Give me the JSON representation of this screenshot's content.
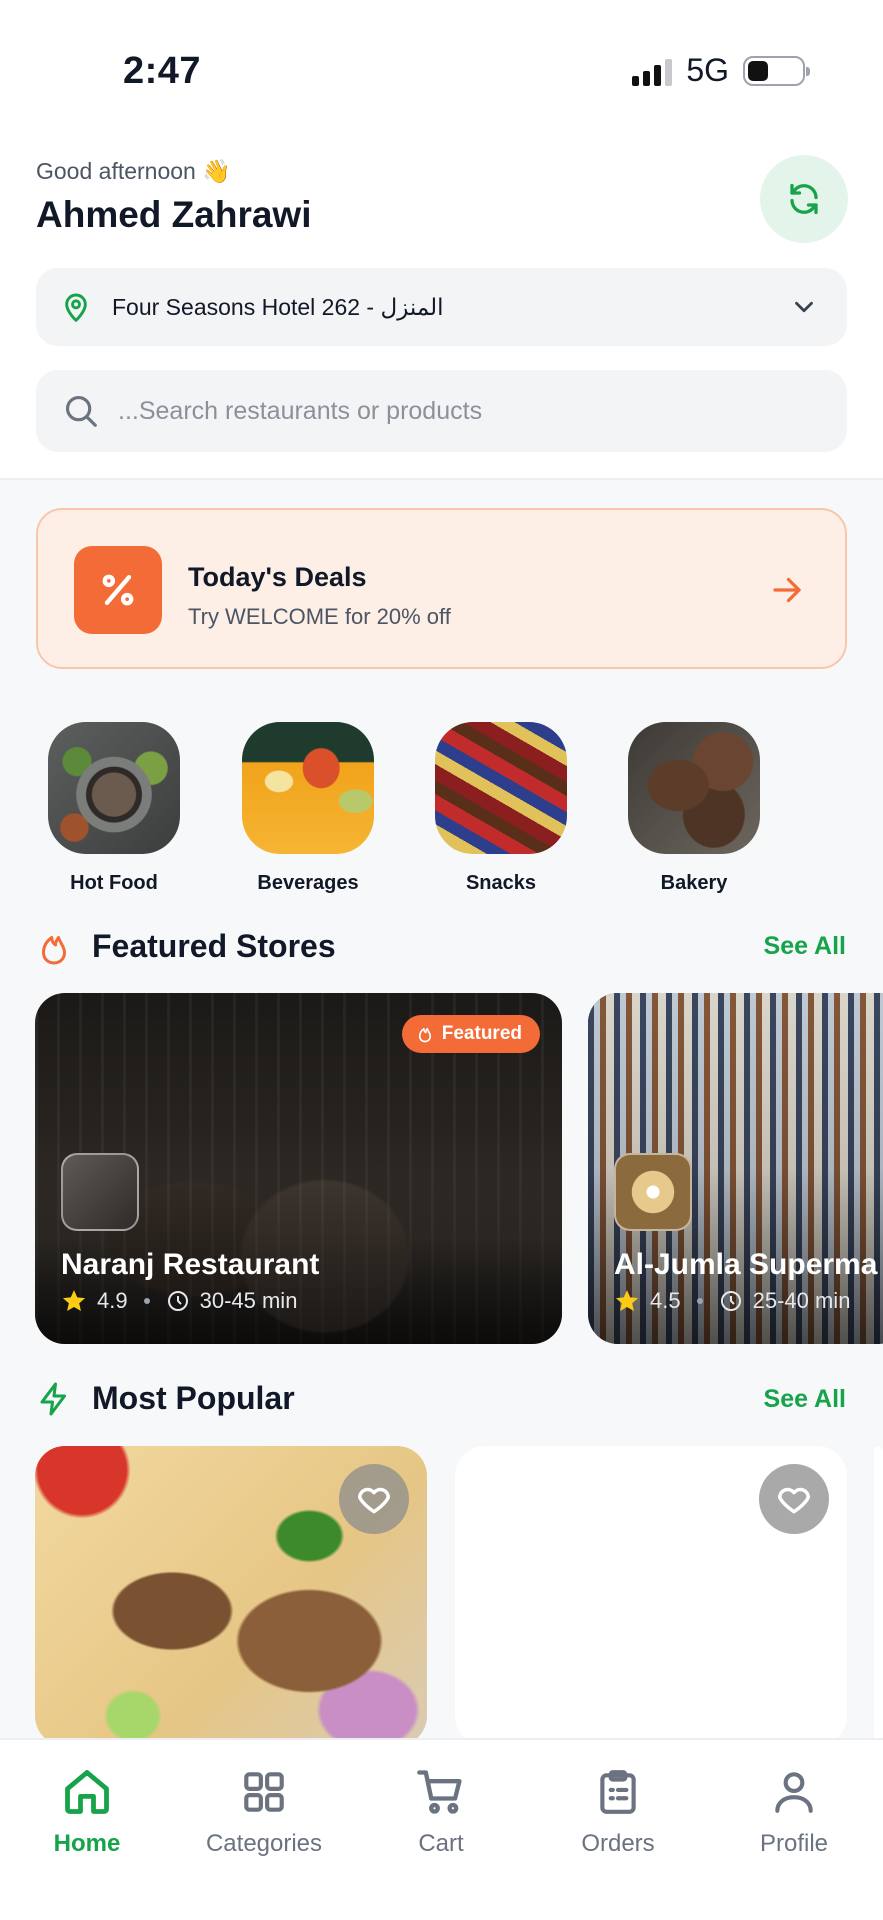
{
  "status_bar": {
    "time": "2:47",
    "network": "5G"
  },
  "header": {
    "greeting": "Good afternoon 👋",
    "user_name": "Ahmed Zahrawi",
    "refresh_icon": "refresh-icon"
  },
  "address": {
    "text": "Four Seasons Hotel 262 - المنزل",
    "icon": "location-pin-icon"
  },
  "search": {
    "placeholder": "...Search restaurants or products"
  },
  "deals": {
    "title": "Today's Deals",
    "subtitle": "Try WELCOME for 20% off",
    "icon": "percent-icon"
  },
  "categories": [
    {
      "label": "Hot Food"
    },
    {
      "label": "Beverages"
    },
    {
      "label": "Snacks"
    },
    {
      "label": "Bakery"
    }
  ],
  "featured": {
    "title": "Featured Stores",
    "see_all": "See All",
    "stores": [
      {
        "name": "Naranj Restaurant",
        "rating": "4.9",
        "time": "30-45 min",
        "badge": "Featured"
      },
      {
        "name": "Al-Jumla Superma",
        "rating": "4.5",
        "time": "25-40 min"
      }
    ]
  },
  "popular": {
    "title": "Most Popular",
    "see_all": "See All"
  },
  "nav": {
    "items": [
      {
        "label": "Home",
        "icon": "home-icon",
        "active": true
      },
      {
        "label": "Categories",
        "icon": "grid-icon"
      },
      {
        "label": "Cart",
        "icon": "cart-icon"
      },
      {
        "label": "Orders",
        "icon": "clipboard-icon"
      },
      {
        "label": "Profile",
        "icon": "user-icon"
      }
    ]
  },
  "colors": {
    "accent": "#16a34a",
    "deal": "#f36b36",
    "deal_bg": "#fdeee6"
  }
}
